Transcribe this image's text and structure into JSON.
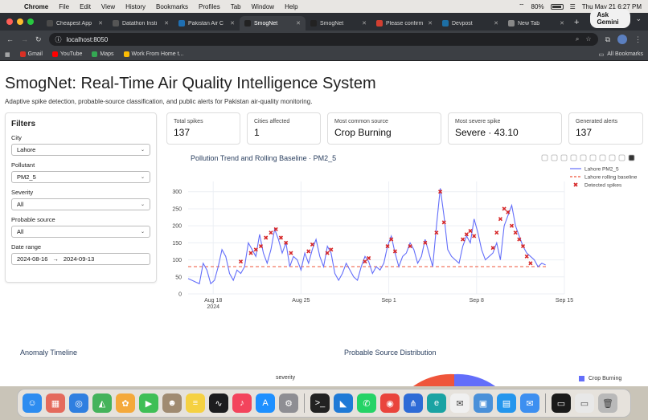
{
  "menubar": {
    "app": "Chrome",
    "items": [
      "File",
      "Edit",
      "View",
      "History",
      "Bookmarks",
      "Profiles",
      "Tab",
      "Window",
      "Help"
    ],
    "battery": "80%",
    "clock": "Thu May 21  6:27 PM"
  },
  "tabs": [
    {
      "title": "Cheapest App",
      "color": "#4a4a4a",
      "active": false
    },
    {
      "title": "Datathon Insti",
      "color": "#555555",
      "active": false
    },
    {
      "title": "Pakistan Air C",
      "color": "#1f6fb2",
      "active": false
    },
    {
      "title": "SmogNet",
      "color": "#222222",
      "active": true
    },
    {
      "title": "SmogNet",
      "color": "#222222",
      "active": false
    },
    {
      "title": "Please confirm",
      "color": "#d23f31",
      "active": false
    },
    {
      "title": "Devpost",
      "color": "#1d6fa5",
      "active": false
    },
    {
      "title": "New Tab",
      "color": "#888888",
      "active": false
    }
  ],
  "browser": {
    "gemini_label": "Ask Gemini",
    "url": "localhost:8050"
  },
  "bookmarks": [
    {
      "label": "Gmail",
      "color": "#d93025"
    },
    {
      "label": "YouTube",
      "color": "#ff0000"
    },
    {
      "label": "Maps",
      "color": "#34a853"
    },
    {
      "label": "Work From Home t...",
      "color": "#fbbc04"
    }
  ],
  "bookmarks_right": "All Bookmarks",
  "app": {
    "title": "SmogNet: Real-Time Air Quality Intelligence System",
    "subtitle": "Adaptive spike detection, probable-source classification, and public alerts for Pakistan air-quality monitoring."
  },
  "filters": {
    "heading": "Filters",
    "city": {
      "label": "City",
      "value": "Lahore"
    },
    "pollutant": {
      "label": "Pollutant",
      "value": "PM2_5"
    },
    "severity": {
      "label": "Severity",
      "value": "All"
    },
    "source": {
      "label": "Probable source",
      "value": "All"
    },
    "date": {
      "label": "Date range",
      "start": "2024-08-16",
      "arrow": "→",
      "end": "2024-09-13"
    }
  },
  "cards": [
    {
      "label": "Total spikes",
      "value": "137"
    },
    {
      "label": "Cities affected",
      "value": "1"
    },
    {
      "label": "Most common source",
      "value": "Crop Burning"
    },
    {
      "label": "Most severe spike",
      "value": "Severe · 43.10"
    },
    {
      "label": "Generated alerts",
      "value": "137"
    }
  ],
  "chart_data": {
    "type": "line",
    "title": "Pollution Trend and Rolling Baseline · PM2_5",
    "legend": [
      "Lahore PM2_5",
      "Lahore rolling baseline",
      "Detected spikes"
    ],
    "legend_position": "top-right",
    "x_ticks": [
      "Aug 18\n2024",
      "Aug 25",
      "Sep 1",
      "Sep 8",
      "Sep 15"
    ],
    "y_ticks": [
      0,
      50,
      100,
      150,
      200,
      250,
      300
    ],
    "ylim": [
      0,
      330
    ],
    "xlim": [
      "2024-08-16",
      "2024-09-15"
    ],
    "baseline": 80,
    "grid": true,
    "colors": {
      "line": "#636efa",
      "baseline": "#ef553b",
      "spikes": "#d62728"
    },
    "series_days": [
      0.0,
      0.3,
      0.6,
      0.9,
      1.2,
      1.5,
      1.8,
      2.1,
      2.4,
      2.7,
      3.0,
      3.3,
      3.6,
      3.9,
      4.2,
      4.5,
      4.8,
      5.1,
      5.4,
      5.7,
      6.0,
      6.3,
      6.6,
      6.9,
      7.2,
      7.5,
      7.8,
      8.1,
      8.4,
      8.7,
      9.0,
      9.3,
      9.6,
      9.9,
      10.2,
      10.5,
      10.8,
      11.1,
      11.4,
      11.7,
      12.0,
      12.3,
      12.6,
      12.9,
      13.2,
      13.5,
      13.8,
      14.1,
      14.4,
      14.7,
      15.0,
      15.3,
      15.6,
      15.9,
      16.2,
      16.5,
      16.8,
      17.1,
      17.4,
      17.7,
      18.0,
      18.3,
      18.6,
      18.9,
      19.2,
      19.5,
      19.8,
      20.1,
      20.4,
      20.7,
      21.0,
      21.3,
      21.6,
      21.9,
      22.2,
      22.5,
      22.8,
      23.1,
      23.4,
      23.7,
      24.0,
      24.3,
      24.6,
      24.9,
      25.2,
      25.5,
      25.8,
      26.1,
      26.4,
      26.7,
      27.0,
      27.3,
      27.6,
      27.9,
      28.2,
      28.5
    ],
    "series_values": [
      45,
      40,
      35,
      30,
      90,
      70,
      30,
      40,
      80,
      130,
      110,
      60,
      40,
      70,
      60,
      80,
      150,
      130,
      110,
      175,
      120,
      90,
      130,
      190,
      160,
      120,
      150,
      80,
      110,
      100,
      70,
      120,
      90,
      130,
      160,
      110,
      80,
      140,
      120,
      60,
      40,
      60,
      90,
      70,
      50,
      40,
      80,
      110,
      95,
      60,
      80,
      70,
      90,
      140,
      170,
      120,
      80,
      110,
      120,
      150,
      130,
      90,
      110,
      160,
      120,
      80,
      200,
      310,
      230,
      130,
      110,
      100,
      90,
      140,
      170,
      150,
      220,
      180,
      130,
      100,
      110,
      120,
      150,
      100,
      200,
      230,
      260,
      200,
      170,
      140,
      120,
      110,
      100,
      80,
      90,
      85
    ],
    "spike_days": [
      4.2,
      5.0,
      5.4,
      5.8,
      6.2,
      6.6,
      7.0,
      7.4,
      7.8,
      8.2,
      9.6,
      9.9,
      11.1,
      11.4,
      14.1,
      14.4,
      15.9,
      16.2,
      16.5,
      17.7,
      18.9,
      19.8,
      20.1,
      20.4,
      21.9,
      22.2,
      22.5,
      22.8,
      24.3,
      24.6,
      24.9,
      25.2,
      25.5,
      25.8,
      26.1,
      26.4,
      26.7,
      27.0,
      27.3
    ],
    "spike_values": [
      95,
      120,
      130,
      140,
      165,
      180,
      190,
      165,
      150,
      120,
      125,
      145,
      120,
      130,
      95,
      105,
      140,
      160,
      125,
      140,
      150,
      180,
      300,
      210,
      160,
      175,
      185,
      170,
      135,
      180,
      220,
      250,
      240,
      200,
      180,
      160,
      140,
      110,
      90
    ]
  },
  "bottom": {
    "anomaly_title": "Anomaly Timeline",
    "source_title": "Probable Source Distribution",
    "severity_label": "severity",
    "pie_legend": "Crop Burning"
  },
  "dock": [
    {
      "name": "finder-icon",
      "color": "#2d8cf0",
      "glyph": "☺"
    },
    {
      "name": "launchpad-icon",
      "color": "#e46a5c",
      "glyph": "▦"
    },
    {
      "name": "safari-icon",
      "color": "#2f7fe0",
      "glyph": "◎"
    },
    {
      "name": "maps-icon",
      "color": "#44b35b",
      "glyph": "◭"
    },
    {
      "name": "photos-icon",
      "color": "#f4a93b",
      "glyph": "✿"
    },
    {
      "name": "facetime-icon",
      "color": "#3fbf56",
      "glyph": "▶"
    },
    {
      "name": "contacts-icon",
      "color": "#a08b71",
      "glyph": "☻"
    },
    {
      "name": "notes-icon",
      "color": "#f5d142",
      "glyph": "≡"
    },
    {
      "name": "stocks-icon",
      "color": "#1c1c1e",
      "glyph": "∿"
    },
    {
      "name": "music-icon",
      "color": "#f3445c",
      "glyph": "♪"
    },
    {
      "name": "appstore-icon",
      "color": "#1e90ff",
      "glyph": "A"
    },
    {
      "name": "settings-icon",
      "color": "#8e8e93",
      "glyph": "⚙"
    },
    {
      "name": "terminal-icon",
      "color": "#222222",
      "glyph": ">_"
    },
    {
      "name": "vscode-icon",
      "color": "#1f7ad6",
      "glyph": "◣"
    },
    {
      "name": "whatsapp-icon",
      "color": "#25d366",
      "glyph": "✆"
    },
    {
      "name": "chrome-icon",
      "color": "#e9453c",
      "glyph": "◉"
    },
    {
      "name": "sourcetree-icon",
      "color": "#2e6bd6",
      "glyph": "⋔"
    },
    {
      "name": "edge-icon",
      "color": "#1aa3a3",
      "glyph": "e"
    },
    {
      "name": "mail-send-icon",
      "color": "#f0f0f0",
      "glyph": "✉"
    },
    {
      "name": "preview-icon",
      "color": "#4a90d9",
      "glyph": "▣"
    },
    {
      "name": "docker-icon",
      "color": "#2496ed",
      "glyph": "▤"
    },
    {
      "name": "mail-icon",
      "color": "#3d8ff0",
      "glyph": "✉"
    },
    {
      "name": "window-thumbnail-icon",
      "color": "#1a1a1a",
      "glyph": "▭"
    },
    {
      "name": "window-thumbnail-2-icon",
      "color": "#e8e8e8",
      "glyph": "▭"
    },
    {
      "name": "trash-icon",
      "color": "#b9b9b9",
      "glyph": "🗑"
    }
  ]
}
